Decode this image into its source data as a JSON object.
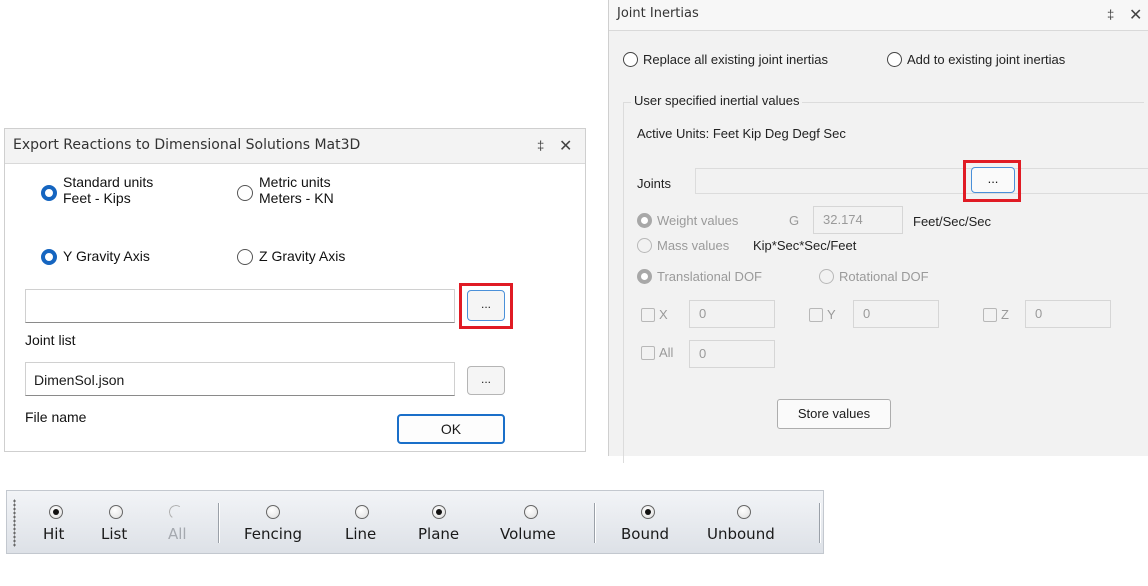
{
  "export_panel": {
    "title": "Export Reactions to Dimensional Solutions Mat3D",
    "pin_glyph": "‡",
    "close_glyph": "✕",
    "standard_units_line1": "Standard units",
    "standard_units_line2": "Feet - Kips",
    "metric_units_line1": "Metric units",
    "metric_units_line2": "Meters - KN",
    "y_gravity": "Y Gravity Axis",
    "z_gravity": "Z Gravity Axis",
    "joint_list_value": "",
    "joint_list_label": "Joint list",
    "file_name_value": "DimenSol.json",
    "file_name_label": "File name",
    "browse_label": "...",
    "ok_label": "OK"
  },
  "inertias_panel": {
    "title": "Joint Inertias",
    "pin_glyph": "‡",
    "close_glyph": "✕",
    "replace_label": "Replace all existing joint inertias",
    "add_label": "Add to existing joint inertias",
    "group_title": "User specified inertial values",
    "active_units": "Active Units: Feet Kip Deg Degf Sec",
    "joints_label": "Joints",
    "joints_value": "",
    "browse_label": "...",
    "weight_values": "Weight values",
    "g_label": "G",
    "g_value": "32.174",
    "g_units": "Feet/Sec/Sec",
    "mass_values": "Mass values",
    "mass_units": "Kip*Sec*Sec/Feet",
    "translational": "Translational DOF",
    "rotational": "Rotational DOF",
    "x_label": "X",
    "x_value": "0",
    "y_label": "Y",
    "y_value": "0",
    "z_label": "Z",
    "z_value": "0",
    "all_label": "All",
    "all_value": "0",
    "store_label": "Store values"
  },
  "toolbar": {
    "hit": "Hit",
    "list": "List",
    "all": "All",
    "fencing": "Fencing",
    "line": "Line",
    "plane": "Plane",
    "volume": "Volume",
    "bound": "Bound",
    "unbound": "Unbound"
  },
  "colors": {
    "accent": "#1565c0",
    "highlight": "#e01b24"
  }
}
